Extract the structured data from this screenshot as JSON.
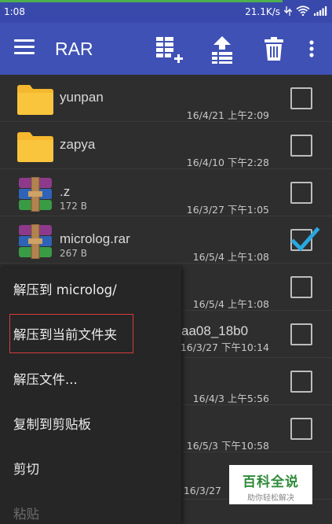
{
  "status_bar": {
    "time": "1:08",
    "net_speed": "21.1K/s",
    "progress": 0.85
  },
  "toolbar": {
    "title": "RAR",
    "icons": [
      "menu-icon",
      "add-to-archive-icon",
      "extract-icon",
      "delete-icon",
      "more-icon"
    ]
  },
  "colors": {
    "toolbar": "#3f51b5",
    "status_bar": "#3949ab",
    "background": "#2e2e2e",
    "check_accent": "#29a8e0",
    "highlight_box": "#d93b3b",
    "watermark_green": "#2e8b3a"
  },
  "files": [
    {
      "name": "yunpan",
      "size": "",
      "date": "16/4/21 上午2:09",
      "type": "folder",
      "checked": false
    },
    {
      "name": "zapya",
      "size": "",
      "date": "16/4/10 下午2:28",
      "type": "folder",
      "checked": false
    },
    {
      "name": ".z",
      "size": "172 B",
      "date": "16/3/27 下午1:05",
      "type": "archive",
      "checked": false
    },
    {
      "name": "microlog.rar",
      "size": "267 B",
      "date": "16/5/4 上午1:08",
      "type": "archive",
      "checked": true
    },
    {
      "name": "",
      "size": "",
      "date": "16/5/4 上午1:08",
      "type": "archive",
      "checked": false
    },
    {
      "name": "aa08_18b0",
      "size": "",
      "date": "16/3/27 下午10:14",
      "type": "archive",
      "checked": false
    },
    {
      "name": "",
      "size": "",
      "date": "16/4/3 上午5:56",
      "type": "archive",
      "checked": false
    },
    {
      "name": "",
      "size": "",
      "date": "16/5/3 下午10:58",
      "type": "archive",
      "checked": false
    },
    {
      "name": "",
      "size": "",
      "date": "16/3/27",
      "type": "archive",
      "checked": false
    }
  ],
  "context_menu": {
    "items": [
      {
        "label": "解压到 microlog/",
        "enabled": true
      },
      {
        "label": "解压到当前文件夹",
        "enabled": true
      },
      {
        "label": "解压文件...",
        "enabled": true
      },
      {
        "label": "复制到剪贴板",
        "enabled": true
      },
      {
        "label": "剪切",
        "enabled": true
      },
      {
        "label": "粘贴",
        "enabled": false
      }
    ]
  },
  "watermark": {
    "title": "百科全说",
    "subtitle": "助你轻松解决"
  }
}
